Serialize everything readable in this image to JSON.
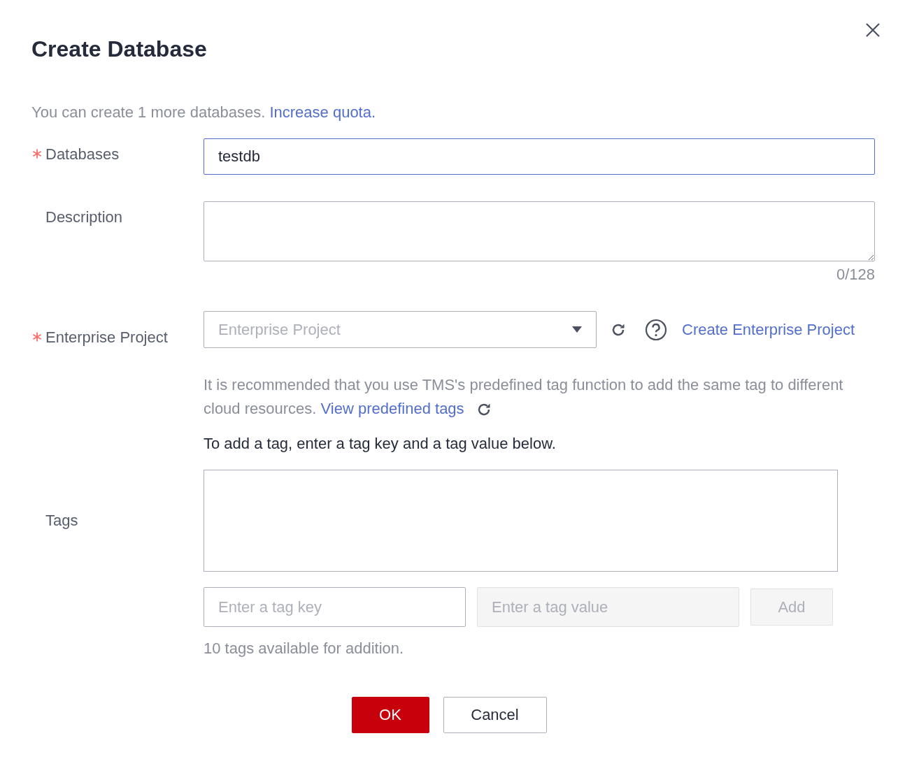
{
  "dialog": {
    "title": "Create Database"
  },
  "quota": {
    "text": "You can create 1 more databases.",
    "link": "Increase quota."
  },
  "databases": {
    "label": "Databases",
    "required": true,
    "value": "testdb",
    "focused": true
  },
  "description": {
    "label": "Description",
    "required": false,
    "counter": "0/128"
  },
  "enterprise_project": {
    "label": "Enterprise Project",
    "required": true,
    "placeholder": "Enterprise Project",
    "link": "Create Enterprise Project"
  },
  "tags": {
    "label": "Tags",
    "hint": "It is recommended that you use TMS's predefined tag function to add the same tag to different cloud resources.",
    "hint_link": "View predefined tags",
    "instruction": "To add a tag, enter a tag key and a tag value below.",
    "key": {
      "placeholder": "Enter a tag key",
      "disabled": false
    },
    "value": {
      "placeholder": "Enter a tag value",
      "disabled": true
    },
    "add": {
      "label": "Add",
      "disabled": true
    },
    "remaining": "10 tags available for addition."
  },
  "buttons": [
    {
      "label": "OK",
      "kind": "primary"
    },
    {
      "label": "Cancel",
      "kind": "secondary"
    }
  ]
}
